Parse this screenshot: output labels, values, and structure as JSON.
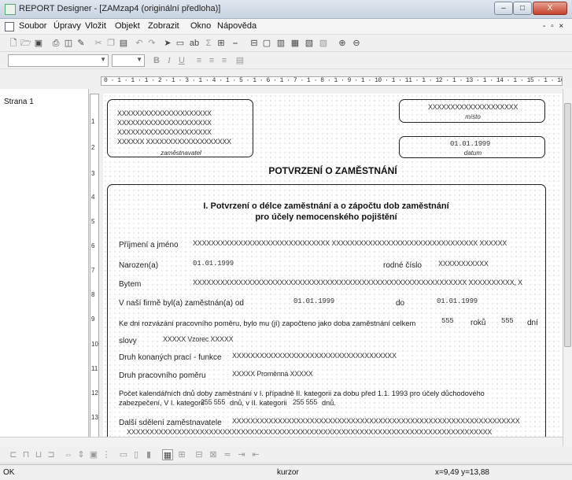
{
  "window": {
    "title": "REPORT Designer - [ZAMzap4 (originální předloha)]",
    "min_label": "–",
    "max_label": "□",
    "close_label": "X",
    "mdi_controls": "- ▫ ×"
  },
  "menu": {
    "items": [
      "Soubor",
      "Úpravy",
      "Vložit",
      "Objekt",
      "Zobrazit",
      "Okno",
      "Nápověda"
    ]
  },
  "toolbar2": {
    "font_value": "",
    "size_value": "",
    "bold": "B",
    "italic": "I",
    "underline": "U"
  },
  "ruler": {
    "marks": "0 · 1 · 1 · 1 · 2 · 1 · 3 · 1 · 4 · 1 · 5 · 1 · 6 · 1 · 7 · 1 · 8 · 1 · 9 · 1 · 10 · 1 · 11 · 1 · 12 · 1 · 13 · 1 · 14 · 1 · 15 · 1 · 16 · 1 · 17 · 1"
  },
  "pages": {
    "items": [
      "Strana 1"
    ]
  },
  "vruler": {
    "numbers": [
      "1",
      "2",
      "3",
      "4",
      "5",
      "6",
      "7",
      "8",
      "9",
      "10",
      "11",
      "12",
      "13"
    ]
  },
  "doc": {
    "employer_lines": [
      "XXXXXXXXXXXXXXXXXXXXX",
      "XXXXXXXXXXXXXXXXXXXXX",
      "XXXXXXXXXXXXXXXXXXXXX",
      "XXXXXX XXXXXXXXXXXXXXXXXXX"
    ],
    "employer_caption": "zaměstnavatel",
    "place_value": "XXXXXXXXXXXXXXXXXXXX",
    "place_caption": "místo",
    "date_value": "01.01.1999",
    "date_caption": "datum",
    "main_title": "POTVRZENÍ O ZAMĚSTNÁNÍ",
    "section_title_1": "I. Potvrzení o délce zaměstnání a o zápočtu dob zaměstnání",
    "section_title_2": "pro účely nemocenského pojištění",
    "f_name_label": "Příjmení a jméno",
    "f_name_value": "XXXXXXXXXXXXXXXXXXXXXXXXXXXXXX XXXXXXXXXXXXXXXXXXXXXXXXXXXXXXXX XXXXXX",
    "f_born_label": "Narozen(a)",
    "f_born_value": "01.01.1999",
    "f_rc_label": "rodné číslo",
    "f_rc_value": "XXXXXXXXXXX",
    "f_addr_label": "Bytem",
    "f_addr_value": "XXXXXXXXXXXXXXXXXXXXXXXXXXXXXXXXXXXXXXXXXXXXXXXXXXXXXXXXXXXX XXXXXXXXXX, X",
    "f_emp_label": "V naší firmě byl(a) zaměstnán(a) od",
    "f_emp_from": "01.01.1999",
    "f_emp_to_label": "do",
    "f_emp_to": "01.01.1999",
    "f_period_label": "Ke dni rozvázání pracovního poměru, bylo mu (jí) započteno jako doba zaměstnání celkem",
    "f_years": "555",
    "f_years_label": "roků",
    "f_days": "555",
    "f_days_label": "dní",
    "f_words_label": "slovy",
    "f_words_value": "XXXXX Vzorec XXXXX",
    "f_work_label": "Druh konaných prací - funkce",
    "f_work_value": "XXXXXXXXXXXXXXXXXXXXXXXXXXXXXXXXXXXX",
    "f_rel_label": "Druh pracovního poměru",
    "f_rel_value": "XXXXX Proměnná XXXXX",
    "f_cat_line1": "Počet kalendářních dnů doby zaměstnání v I. případně II. kategorii za dobu před 1.1. 1993 pro účely důchodového",
    "f_cat_line2a": "zabezpečení, V I. kategorii",
    "f_cat_v1": "255 555",
    "f_cat_line2b": "dnů, v II. kategorii",
    "f_cat_v2": "255 555",
    "f_cat_line2c": "dnů.",
    "f_more_label": "Další sdělení zaměstnavatele",
    "f_more_value": "XXXXXXXXXXXXXXXXXXXXXXXXXXXXXXXXXXXXXXXXXXXXXXXXXXXXXXXXXXXXXXX",
    "f_more_value2": "XXXXXXXXXXXXXXXXXXXXXXXXXXXXXXXXXXXXXXXXXXXXXXXXXXXXXXXXXXXXXXXXXXXXXXXXXXXXXXXX"
  },
  "status": {
    "left": "OK",
    "mid": "kurzor",
    "coords": "x=9,49  y=13,88"
  }
}
